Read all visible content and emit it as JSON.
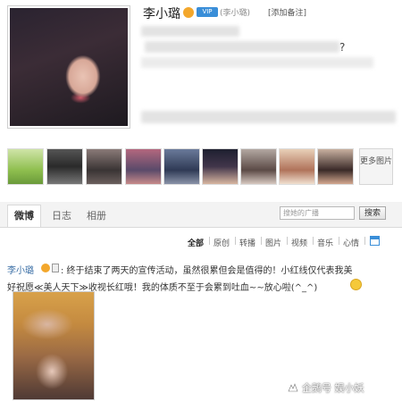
{
  "profile": {
    "name": "李小璐",
    "member_badge": "VIP",
    "alias": "(李小璐)",
    "add_note": "[添加备注]",
    "bio_suffix": "?",
    "more_photos": "更多图片"
  },
  "tabs": [
    {
      "label": "微博"
    },
    {
      "label": "日志"
    },
    {
      "label": "相册"
    }
  ],
  "search": {
    "placeholder": "搜她的广播",
    "button": "搜索"
  },
  "filters": [
    "全部",
    "原创",
    "转播",
    "图片",
    "视频",
    "音乐",
    "心情"
  ],
  "post": {
    "author": "李小璐",
    "text_line1": ": 终于结束了两天的宣传活动，虽然很累但会是值得的！小红线仅代表我美",
    "text_line2": "好祝愿≪美人天下≫收视长红哦！我的体质不至于会累到吐血~~放心啦(^_^)"
  },
  "watermark": {
    "text": "企鹅号 娱小妖"
  },
  "colors": {
    "link_blue": "#3a6ea5",
    "verify_orange": "#f3a72c",
    "member_blue": "#3a8ed8"
  }
}
